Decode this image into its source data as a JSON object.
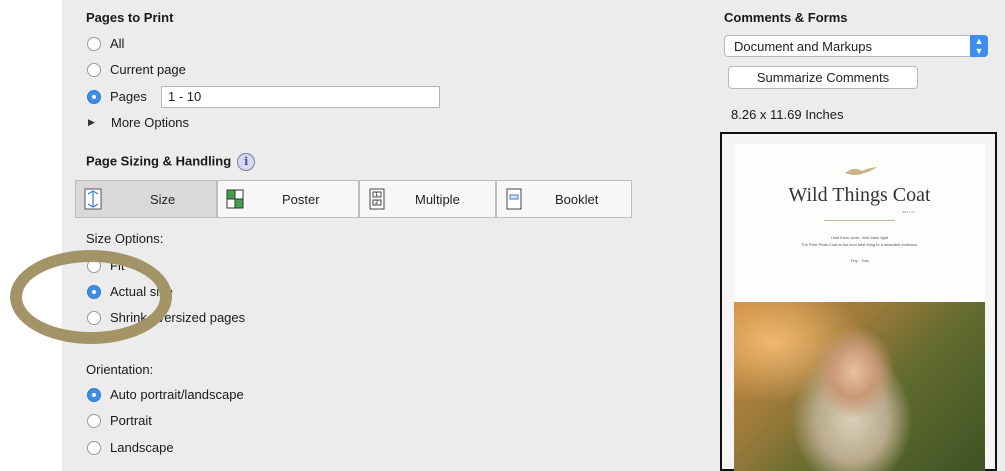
{
  "pages_to_print": {
    "heading": "Pages to Print",
    "options": [
      "All",
      "Current page",
      "Pages"
    ],
    "selected": "Pages",
    "pages_value": "1 - 10",
    "more_options": "More Options"
  },
  "page_sizing": {
    "heading": "Page Sizing & Handling",
    "info_glyph": "i",
    "tabs": [
      "Size",
      "Poster",
      "Multiple",
      "Booklet"
    ],
    "selected_tab": "Size",
    "size_options_label": "Size Options:",
    "size_options": [
      "Fit",
      "Actual size",
      "Shrink oversized pages"
    ],
    "size_selected": "Actual size"
  },
  "orientation": {
    "label": "Orientation:",
    "options": [
      "Auto portrait/landscape",
      "Portrait",
      "Landscape"
    ],
    "selected": "Auto portrait/landscape"
  },
  "comments_forms": {
    "heading": "Comments & Forms",
    "dropdown_value": "Document and Markups",
    "summarize_button": "Summarize Comments"
  },
  "preview": {
    "page_size": "8.26 x 11.69 Inches",
    "doc_title": "Wild Things Coat",
    "doc_subtitle": "Hold them close, hold them tight",
    "doc_tagline": "The Pixie Peak Coat is the next best thing to a wearable embrace.",
    "doc_sizes": "Tiny - Tots",
    "doc_brand": "Wild + Co."
  },
  "colors": {
    "accent": "#3d8ee6",
    "panel_bg": "#ececec",
    "highlight_ring": "#a29466"
  }
}
